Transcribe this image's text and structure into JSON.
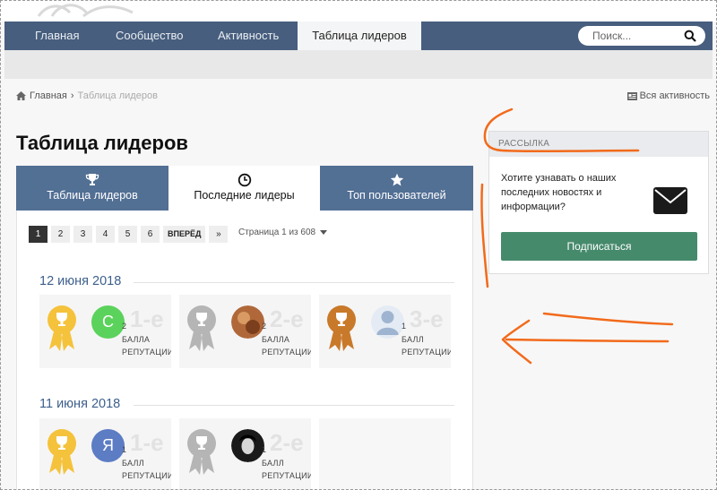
{
  "nav": {
    "items": [
      {
        "label": "Главная",
        "active": false
      },
      {
        "label": "Сообщество",
        "active": false
      },
      {
        "label": "Активность",
        "active": false
      },
      {
        "label": "Таблица лидеров",
        "active": true
      }
    ],
    "search_placeholder": "Поиск...",
    "search_icon": "magnifier"
  },
  "breadcrumb": {
    "home": "Главная",
    "current": "Таблица лидеров",
    "all_activity": "Вся активность"
  },
  "page_title": "Таблица лидеров",
  "tabs": [
    {
      "label": "Таблица лидеров",
      "icon": "trophy",
      "active": false
    },
    {
      "label": "Последние лидеры",
      "icon": "clock",
      "active": true
    },
    {
      "label": "Топ пользователей",
      "icon": "star",
      "active": false
    }
  ],
  "pagination": {
    "pages": [
      "1",
      "2",
      "3",
      "4",
      "5",
      "6"
    ],
    "current": "1",
    "next": "ВПЕРЁД",
    "last": "»",
    "page_of": "Страница 1 из 608"
  },
  "days": [
    {
      "date": "12 июня 2018",
      "leaders": [
        {
          "rank": "1-е",
          "points": "2",
          "unit1": "БАЛЛА",
          "unit2": "РЕПУТАЦИИ",
          "avatar_letter": "С",
          "avatar_color": "#5bd25b",
          "ribbon": "gold"
        },
        {
          "rank": "2-е",
          "points": "2",
          "unit1": "БАЛЛА",
          "unit2": "РЕПУТАЦИИ",
          "avatar_letter": "",
          "avatar_color": "#b0683a",
          "ribbon": "silver"
        },
        {
          "rank": "3-е",
          "points": "1",
          "unit1": "БАЛЛ",
          "unit2": "РЕПУТАЦИИ",
          "avatar_letter": "",
          "avatar_color": "#9fb4d0",
          "ribbon": "bronze"
        }
      ]
    },
    {
      "date": "11 июня 2018",
      "leaders": [
        {
          "rank": "1-е",
          "points": "1",
          "unit1": "БАЛЛ",
          "unit2": "РЕПУТАЦИИ",
          "avatar_letter": "Я",
          "avatar_color": "#5c7cc4",
          "ribbon": "gold"
        },
        {
          "rank": "2-е",
          "points": "1",
          "unit1": "БАЛЛ",
          "unit2": "РЕПУТАЦИИ",
          "avatar_letter": "",
          "avatar_color": "#1a1a1a",
          "ribbon": "silver"
        }
      ]
    }
  ],
  "sidebar": {
    "heading": "РАССЫЛКА",
    "text": "Хотите узнавать о наших последних новостях и информации?",
    "button": "Подписаться",
    "icon": "envelope"
  },
  "colors": {
    "nav_bg": "#475e7e",
    "tab_bg": "#526f94",
    "date_color": "#3d5f8c",
    "subscribe_bg": "#468a6c",
    "annotation": "#f26a1b",
    "gold": "#f5c23c",
    "silver": "#b5b5b5",
    "bronze": "#c9792a"
  }
}
